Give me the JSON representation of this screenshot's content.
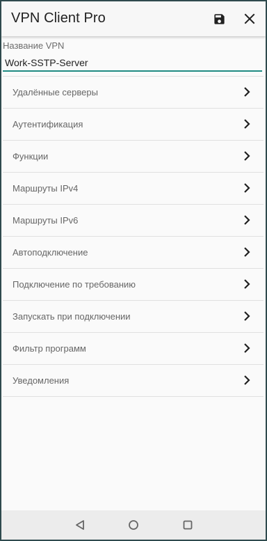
{
  "app_bar": {
    "title": "VPN Client Pro",
    "save_icon": "save-icon",
    "close_icon": "close-icon"
  },
  "vpn_name": {
    "label": "Название VPN",
    "value": "Work-SSTP-Server"
  },
  "menu": {
    "items": [
      {
        "label": "Удалённые серверы"
      },
      {
        "label": "Аутентификация"
      },
      {
        "label": "Функции"
      },
      {
        "label": "Маршруты IPv4"
      },
      {
        "label": "Маршруты IPv6"
      },
      {
        "label": "Автоподключение"
      },
      {
        "label": "Подключение по требованию"
      },
      {
        "label": "Запускать при подключении"
      },
      {
        "label": "Фильтр программ"
      },
      {
        "label": "Уведомления"
      }
    ]
  },
  "nav_bar": {
    "back_icon": "back-triangle-icon",
    "home_icon": "home-circle-icon",
    "recents_icon": "recents-square-icon"
  },
  "colors": {
    "accent": "#1f8a82",
    "frame": "#2f4a4e",
    "background": "#fafafa"
  }
}
